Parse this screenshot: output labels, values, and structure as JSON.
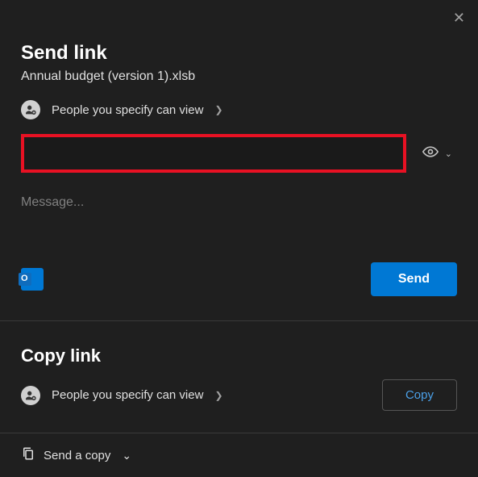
{
  "dialog": {
    "close_aria": "Close"
  },
  "send_section": {
    "title": "Send link",
    "filename": "Annual budget (version 1).xlsb",
    "permission_text": "People you specify can view",
    "recipients_placeholder": "",
    "message_placeholder": "Message...",
    "send_label": "Send"
  },
  "copy_section": {
    "title": "Copy link",
    "permission_text": "People you specify can view",
    "copy_label": "Copy"
  },
  "footer": {
    "send_copy_label": "Send a copy"
  }
}
